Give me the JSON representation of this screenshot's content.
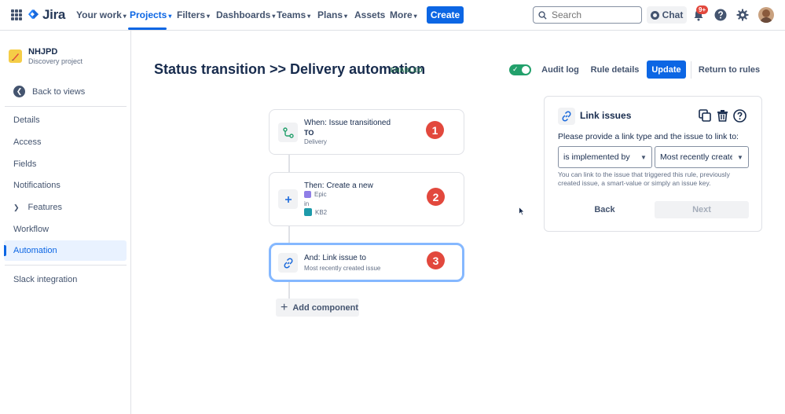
{
  "topnav": {
    "logo_text": "Jira",
    "items": [
      {
        "label": "Your work"
      },
      {
        "label": "Projects"
      },
      {
        "label": "Filters"
      },
      {
        "label": "Dashboards"
      },
      {
        "label": "Teams"
      },
      {
        "label": "Plans"
      },
      {
        "label": "Assets"
      },
      {
        "label": "More"
      }
    ],
    "chevron": "▾",
    "create_label": "Create",
    "search_placeholder": "Search",
    "chat_label": "Chat",
    "notifications_badge": "9+",
    "icons": [
      "app-switcher-icon",
      "jira-logo-icon",
      "search-icon",
      "chat-icon",
      "notifications-icon",
      "help-icon",
      "settings-icon",
      "avatar"
    ]
  },
  "sidebar": {
    "project_name": "NHJPD",
    "project_type": "Discovery project",
    "back_label": "Back to views",
    "items": [
      {
        "label": "Details"
      },
      {
        "label": "Access"
      },
      {
        "label": "Fields"
      },
      {
        "label": "Notifications"
      },
      {
        "label": "Features"
      },
      {
        "label": "Workflow"
      },
      {
        "label": "Automation"
      }
    ],
    "footer_item": "Slack integration"
  },
  "header": {
    "title": "Status transition >> Delivery automation",
    "status": "ENABLED",
    "audit_log": "Audit log",
    "rule_details": "Rule details",
    "update": "Update",
    "return_to_rules": "Return to rules"
  },
  "rule": {
    "trigger": {
      "title": "When: Issue transitioned",
      "to_label": "TO",
      "to_value": "Delivery",
      "number": "1"
    },
    "action": {
      "title": "Then: Create a new",
      "issue_type": "Epic",
      "in_label": "in",
      "project": "KB2",
      "number": "2"
    },
    "branch": {
      "title": "And: Link issue to",
      "subtitle": "Most recently created issue",
      "number": "3"
    },
    "add_component": "Add component"
  },
  "panel": {
    "title": "Link issues",
    "description": "Please provide a link type and the issue to link to:",
    "link_type": "is implemented by",
    "link_target": "Most recently created issue",
    "help": "You can link to the issue that triggered this rule, previously created issue, a smart-value or simply an issue key.",
    "back": "Back",
    "next": "Next"
  },
  "colors": {
    "accent": "#0c66e4",
    "enabled": "#22a06b",
    "badge": "#e2483d"
  }
}
